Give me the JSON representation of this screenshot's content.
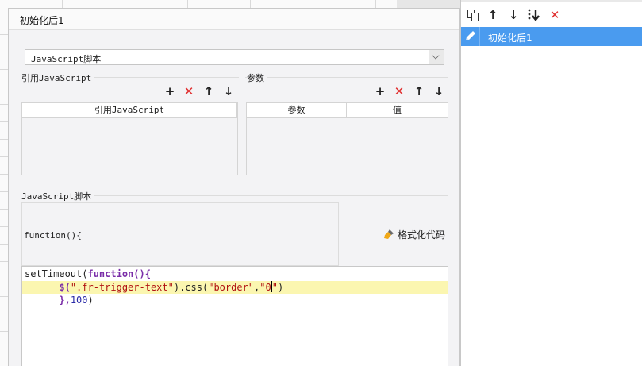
{
  "dialog": {
    "title": "初始化后1",
    "script_type": "JavaScript脚本",
    "ref_js": {
      "label": "引用JavaScript",
      "column": "引用JavaScript"
    },
    "params": {
      "label": "参数",
      "col_param": "参数",
      "col_value": "值"
    },
    "js_script": {
      "label": "JavaScript脚本",
      "func_header": "function(){",
      "format_button": "格式化代码"
    },
    "code": {
      "line1_a": "setTimeout(",
      "line1_kw": "function",
      "line1_b": "(){",
      "line2_indent": "      ",
      "line2_a": "$(",
      "line2_str1": "\".fr-trigger-text\"",
      "line2_b": ").css(",
      "line2_str2": "\"border\"",
      "line2_c": ",",
      "line2_str3a": "\"0",
      "line2_str3b": "\"",
      "line2_d": ")",
      "line3_indent": "      ",
      "line3_a": "},",
      "line3_num": "100",
      "line3_b": ")"
    },
    "toolbar_icons": [
      "add-icon",
      "delete-icon",
      "move-up-icon",
      "move-down-icon"
    ]
  },
  "right_panel": {
    "toolbar_icons": [
      "copy-icon",
      "move-up-icon",
      "move-down-icon",
      "move-bottom-icon",
      "delete-icon"
    ],
    "items": [
      {
        "label": "初始化后1",
        "icon": "edit-pencil-icon",
        "selected": true
      }
    ]
  },
  "colors": {
    "selected": "#4a9bef",
    "delete": "#e03030",
    "highlight_line": "#fbf6b0"
  }
}
